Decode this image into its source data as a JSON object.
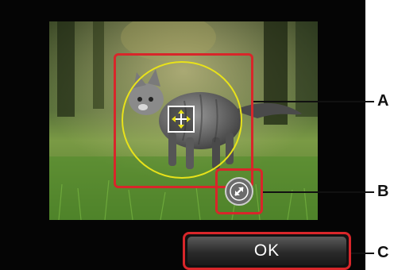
{
  "screen": {
    "ok_label": "OK"
  },
  "callouts": {
    "a": "A",
    "b": "B",
    "c": "C"
  },
  "icons": {
    "move": "four-arrow-move-icon",
    "resize": "diagonal-resize-icon"
  },
  "colors": {
    "highlight": "#d8262a",
    "crop_circle": "#e8e21a"
  }
}
